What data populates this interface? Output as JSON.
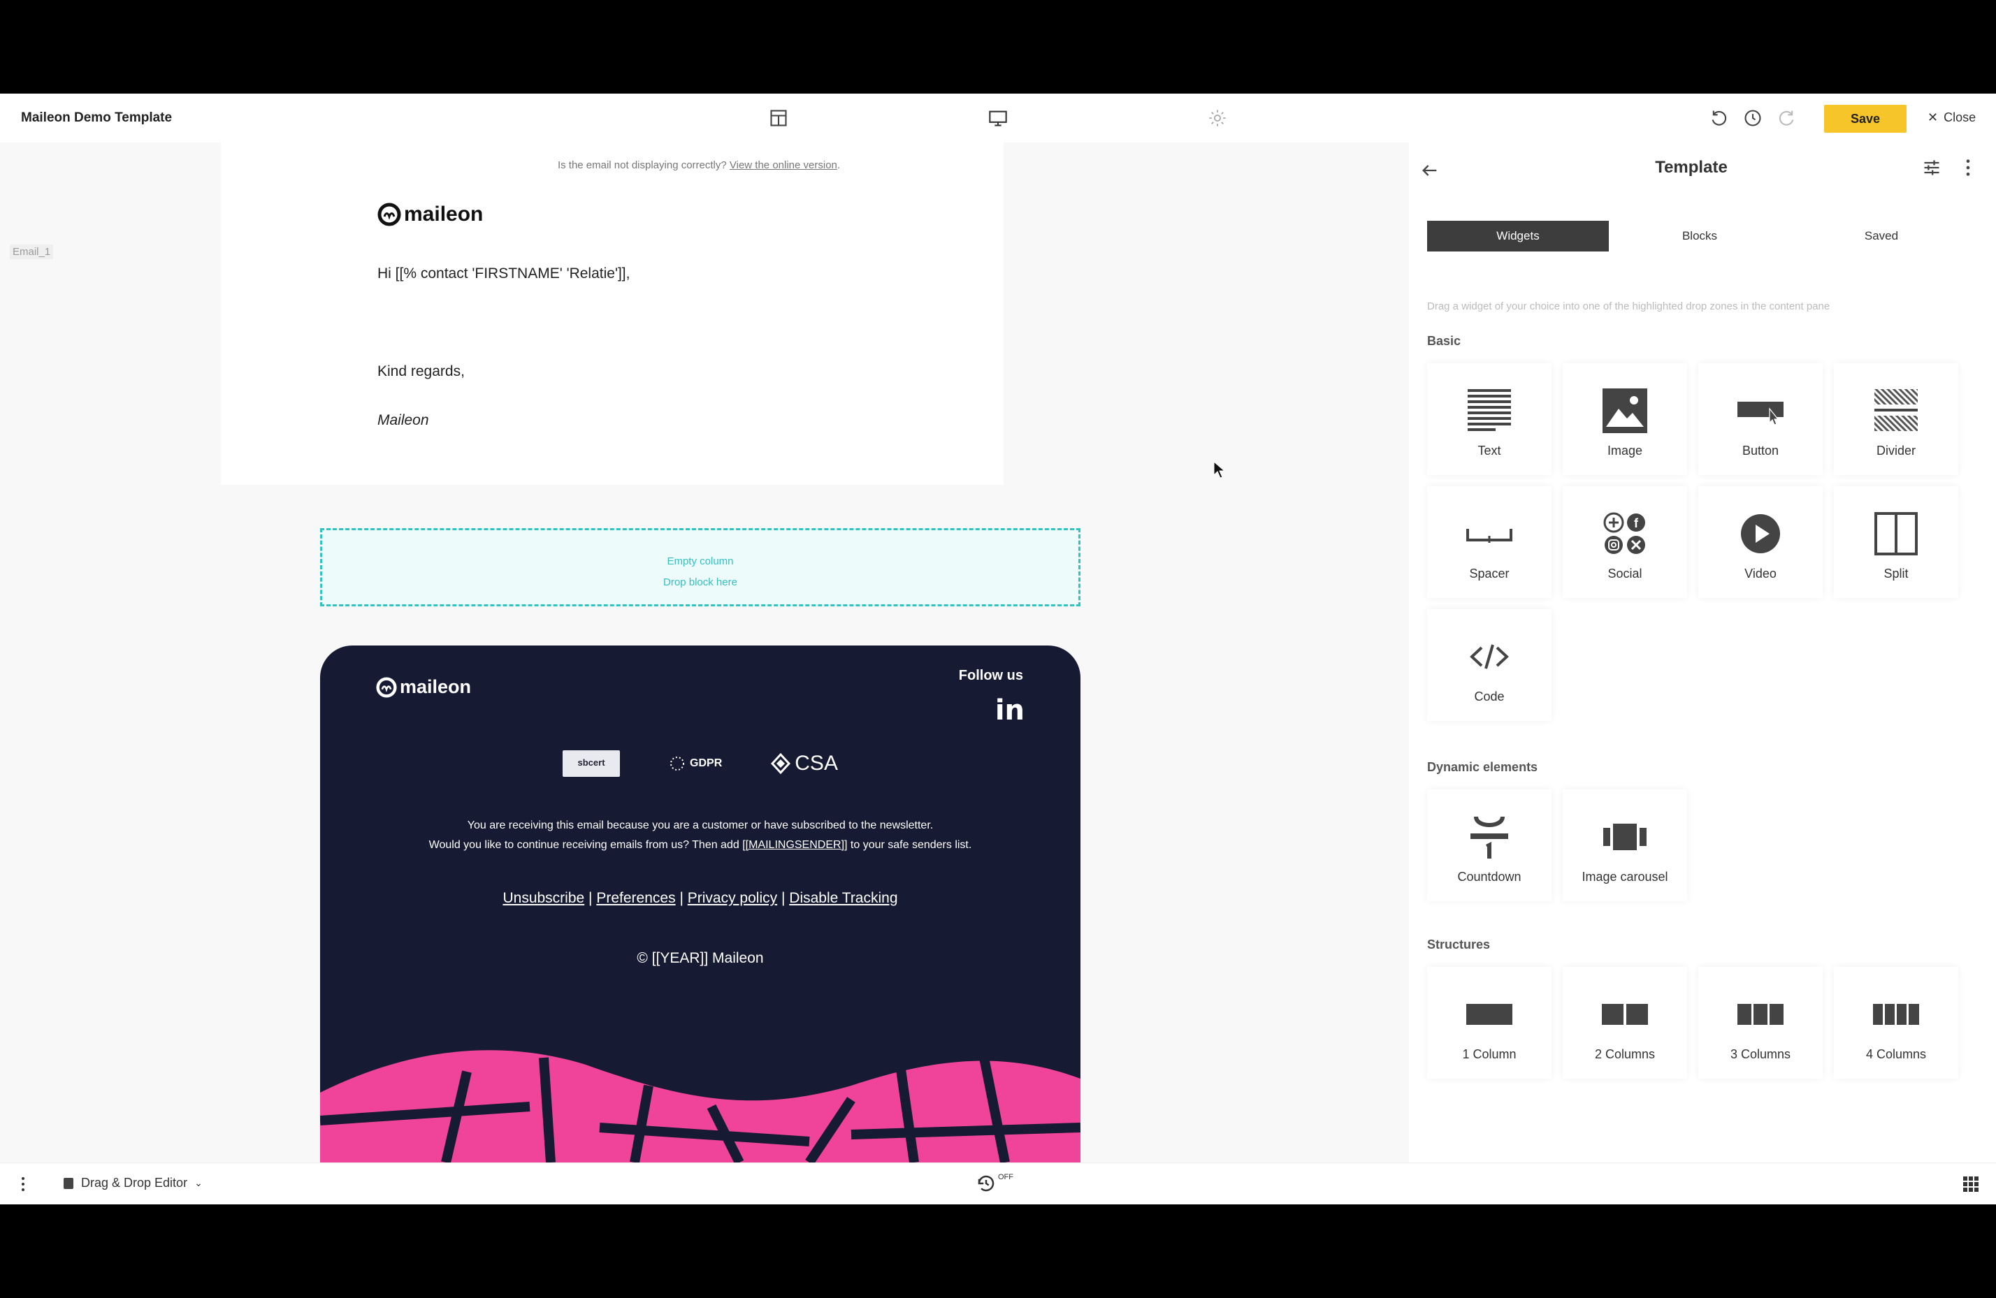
{
  "app": {
    "title": "Maileon Demo Template"
  },
  "toolbar": {
    "save_label": "Save",
    "close_label": "Close",
    "icons": [
      "layout-icon",
      "desktop-preview-icon",
      "settings-icon",
      "undo-icon",
      "history-icon",
      "redo-icon"
    ]
  },
  "canvas": {
    "label": "Email_1",
    "online_prefix": "Is the email not displaying correctly?",
    "online_link": "View the online version",
    "online_suffix": ".",
    "logo_text": "maileon",
    "greeting": "Hi [[% contact 'FIRSTNAME' 'Relatie']],",
    "regards": "Kind regards,",
    "signoff": "Maileon",
    "drop_zone": {
      "line1": "Empty column",
      "line2": "Drop block here"
    },
    "footer": {
      "logo_text": "maileon",
      "follow_us": "Follow us",
      "linkedin": "in",
      "badge_sbcert": "sbcert",
      "badge_gdpr": "GDPR",
      "badge_csa": "CSA",
      "text_line1": "You are receiving this email because you are a customer or have subscribed to the newsletter.",
      "text_line2_prefix": "Would you like to continue receiving emails from us? Then add",
      "text_line2_tag": "[[MAILINGSENDER]]",
      "text_line2_suffix": "to your safe senders list.",
      "links": [
        "Unsubscribe",
        "Preferences",
        "Privacy policy",
        "Disable Tracking"
      ],
      "separator": "|",
      "copyright": "© [[YEAR]] Maileon",
      "accent_color": "#f0449a",
      "background_color": "#161a33"
    }
  },
  "panel": {
    "title": "Template",
    "tabs": [
      {
        "label": "Widgets",
        "active": true
      },
      {
        "label": "Blocks",
        "active": false
      },
      {
        "label": "Saved",
        "active": false
      }
    ],
    "hint": "Drag a widget of your choice into one of the highlighted drop zones in the content pane",
    "sections": {
      "basic": {
        "title": "Basic",
        "items": [
          {
            "label": "Text",
            "icon": "text-icon"
          },
          {
            "label": "Image",
            "icon": "image-icon"
          },
          {
            "label": "Button",
            "icon": "button-icon"
          },
          {
            "label": "Divider",
            "icon": "divider-icon"
          },
          {
            "label": "Spacer",
            "icon": "spacer-icon"
          },
          {
            "label": "Social",
            "icon": "social-icon"
          },
          {
            "label": "Video",
            "icon": "video-icon"
          },
          {
            "label": "Split",
            "icon": "split-icon"
          },
          {
            "label": "Code",
            "icon": "code-icon"
          }
        ]
      },
      "dynamic": {
        "title": "Dynamic elements",
        "items": [
          {
            "label": "Countdown",
            "icon": "countdown-icon"
          },
          {
            "label": "Image carousel",
            "icon": "carousel-icon"
          }
        ]
      },
      "structures": {
        "title": "Structures",
        "items": [
          {
            "label": "1 Column",
            "icon": "one-column-icon"
          },
          {
            "label": "2 Columns",
            "icon": "two-columns-icon"
          },
          {
            "label": "3 Columns",
            "icon": "three-columns-icon"
          },
          {
            "label": "4 Columns",
            "icon": "four-columns-icon"
          }
        ]
      }
    }
  },
  "statusbar": {
    "editor_label": "Drag & Drop Editor",
    "autosave_label": "OFF"
  },
  "colors": {
    "save_button": "#f5c52a",
    "drop_zone_border": "#2ec4c4",
    "active_tab": "#3d3d3d"
  }
}
